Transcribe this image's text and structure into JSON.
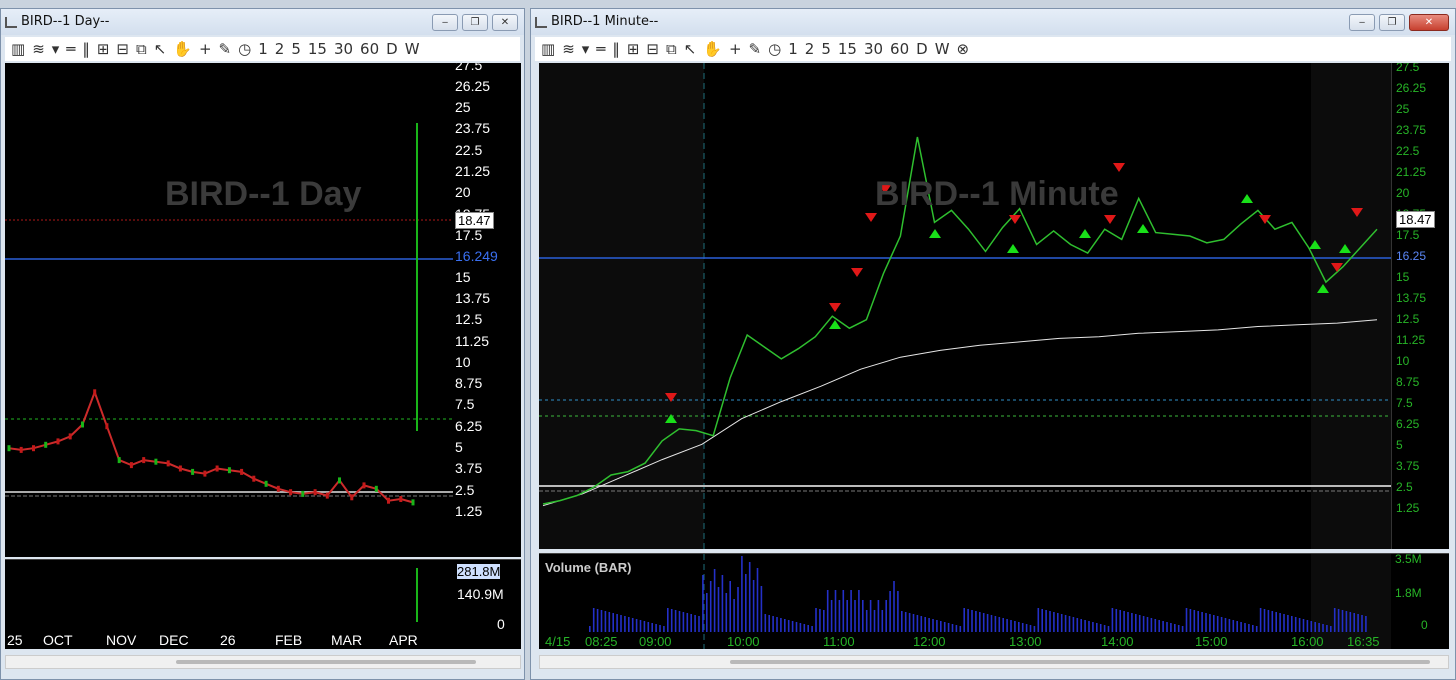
{
  "left_window": {
    "title": "BIRD--1 Day--",
    "watermark": "BIRD--1 Day",
    "toolbar": [
      "1",
      "2",
      "5",
      "15",
      "30",
      "60",
      "D",
      "W"
    ],
    "price_axis": [
      "27.5",
      "26.25",
      "25",
      "23.75",
      "22.5",
      "21.25",
      "20",
      "18.75",
      "17.5",
      "16.25",
      "15",
      "13.75",
      "12.5",
      "11.25",
      "10",
      "8.75",
      "7.5",
      "6.25",
      "5",
      "3.75",
      "2.5",
      "1.25"
    ],
    "last_price": "18.47",
    "blue_line_label": "16.249",
    "volume_axis": [
      "281.8M",
      "140.9M",
      "0"
    ],
    "x_axis": [
      "25",
      "OCT",
      "NOV",
      "DEC",
      "26",
      "FEB",
      "MAR",
      "APR"
    ]
  },
  "right_window": {
    "title": "BIRD--1 Minute--",
    "watermark": "BIRD--1 Minute",
    "toolbar": [
      "1",
      "2",
      "5",
      "15",
      "30",
      "60",
      "D",
      "W"
    ],
    "price_axis": [
      "27.5",
      "26.25",
      "25",
      "23.75",
      "22.5",
      "21.25",
      "20",
      "18.75",
      "17.5",
      "16.25",
      "15",
      "13.75",
      "12.5",
      "11.25",
      "10",
      "8.75",
      "7.5",
      "6.25",
      "5",
      "3.75",
      "2.5",
      "1.25"
    ],
    "last_price": "18.47",
    "blue_line_label": "16.25",
    "volume_title": "Volume (BAR)",
    "volume_axis": [
      "3.5M",
      "1.8M",
      "0"
    ],
    "x_axis": [
      "4/15",
      "08:25",
      "09:00",
      "10:00",
      "11:00",
      "12:00",
      "13:00",
      "14:00",
      "15:00",
      "16:00",
      "16:35"
    ]
  },
  "colors": {
    "up": "#19c219",
    "down": "#d21818",
    "blue": "#2a5fd8",
    "vwap": "#e6e6e6",
    "green_axis": "#27b427"
  },
  "chart_data": [
    {
      "type": "line",
      "series": [
        {
          "values": [
            5.6,
            5.5,
            5.6,
            5.8,
            6.0,
            6.3,
            7.0,
            8.9,
            6.9,
            4.9,
            4.6,
            4.9,
            4.8,
            4.7,
            4.4,
            4.2,
            4.1,
            4.4,
            4.3,
            4.2,
            3.8,
            3.5,
            3.2,
            3.0,
            2.9,
            3.0,
            2.8,
            3.7,
            2.7,
            3.4,
            3.2,
            2.5,
            2.6,
            2.4,
            23.0
          ]
        }
      ],
      "ylim": [
        0,
        28
      ]
    },
    {
      "type": "line",
      "series": [
        {
          "values": [
            2.4,
            2.6,
            2.9,
            3.4,
            4.1,
            4.3,
            4.8,
            6.1,
            6.8,
            6.7,
            6.4,
            9.8,
            12.3,
            11.6,
            10.9,
            11.5,
            12.2,
            13.4,
            12.7,
            13.2,
            15.9,
            18.1,
            23.9,
            18.9,
            19.6,
            18.5,
            17.2,
            18.6,
            19.7,
            17.6,
            18.4,
            17.6,
            17.1,
            18.5,
            17.9,
            20.3,
            18.3,
            18.2,
            18.1,
            17.7,
            17.9,
            18.8,
            19.6,
            18.5,
            18.9,
            17.4,
            15.4,
            16.3,
            17.4,
            18.5
          ]
        },
        {
          "values": [
            2.3,
            3.0,
            4.0,
            5.0,
            5.9,
            7.4,
            8.4,
            9.3,
            10.3,
            11.0,
            11.4,
            11.7,
            11.9,
            12.1,
            12.2,
            12.4,
            12.5,
            12.6,
            12.8,
            12.9,
            13.0,
            13.2
          ]
        }
      ],
      "ylim": [
        0,
        28
      ]
    }
  ]
}
